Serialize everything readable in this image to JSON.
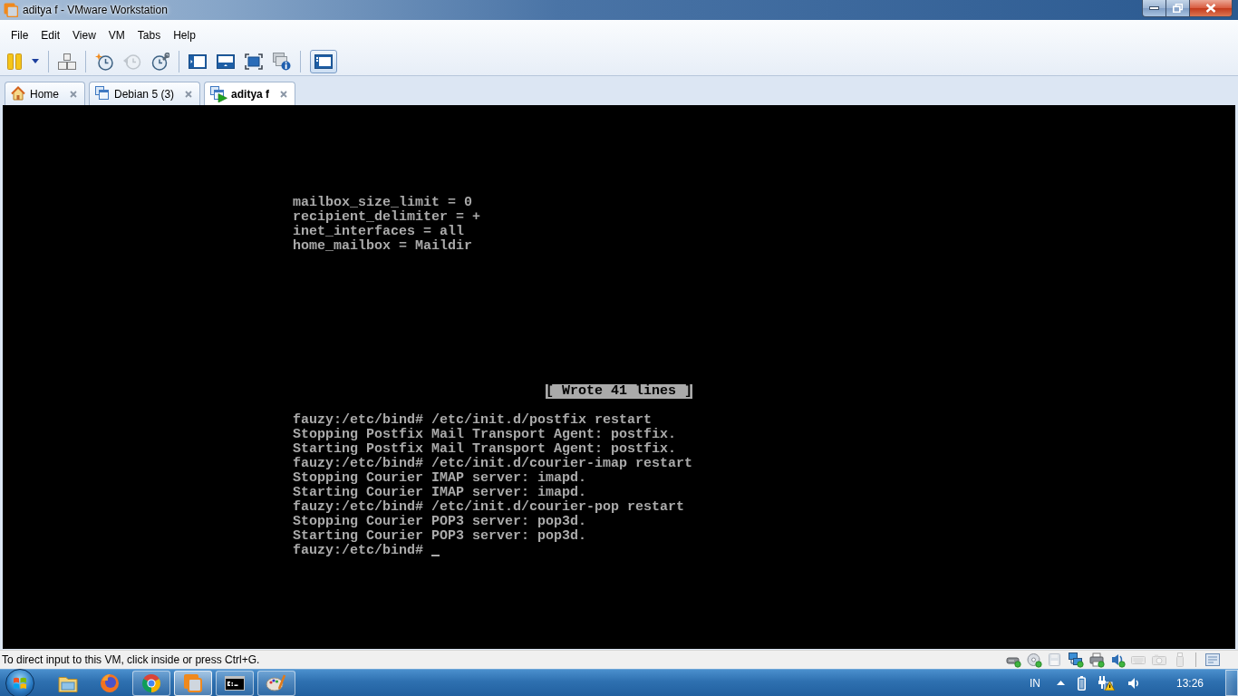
{
  "window": {
    "title": "aditya f - VMware Workstation"
  },
  "menu": [
    "File",
    "Edit",
    "View",
    "VM",
    "Tabs",
    "Help"
  ],
  "toolbar": {
    "groups": [
      [
        {
          "kind": "pause",
          "selected": false,
          "disabled": false
        },
        {
          "kind": "dropdown",
          "selected": false,
          "disabled": false
        }
      ],
      [
        {
          "kind": "send_keys",
          "selected": false,
          "disabled": false
        }
      ],
      [
        {
          "kind": "snapshot",
          "selected": false,
          "disabled": false
        },
        {
          "kind": "revert",
          "selected": false,
          "disabled": true
        },
        {
          "kind": "snapshot_manager",
          "selected": false,
          "disabled": false
        }
      ],
      [
        {
          "kind": "sidebar",
          "selected": false,
          "disabled": false
        },
        {
          "kind": "console_view",
          "selected": false,
          "disabled": false
        },
        {
          "kind": "full_screen",
          "selected": false,
          "disabled": false
        },
        {
          "kind": "unity",
          "selected": false,
          "disabled": false
        }
      ],
      [
        {
          "kind": "thumbnail",
          "selected": true,
          "disabled": false
        }
      ]
    ]
  },
  "tabs": [
    {
      "label": "Home",
      "kind": "home",
      "running": false,
      "selected": false
    },
    {
      "label": "Debian 5 (3)",
      "kind": "vm",
      "running": false,
      "selected": false
    },
    {
      "label": "aditya f",
      "kind": "vm",
      "running": true,
      "selected": true
    }
  ],
  "console": {
    "config_lines": [
      "mailbox_size_limit = 0",
      "recipient_delimiter = +",
      "inet_interfaces = all",
      "home_mailbox = Maildir"
    ],
    "status_message": "[ Wrote 41 lines ]",
    "output_lines": [
      "fauzy:/etc/bind# /etc/init.d/postfix restart",
      "Stopping Postfix Mail Transport Agent: postfix.",
      "Starting Postfix Mail Transport Agent: postfix.",
      "fauzy:/etc/bind# /etc/init.d/courier-imap restart",
      "Stopping Courier IMAP server: imapd.",
      "Starting Courier IMAP server: imapd.",
      "fauzy:/etc/bind# /etc/init.d/courier-pop restart",
      "Stopping Courier POP3 server: pop3d.",
      "Starting Courier POP3 server: pop3d."
    ],
    "prompt": "fauzy:/etc/bind#"
  },
  "status_bar": {
    "message": "To direct input to this VM, click inside or press Ctrl+G.",
    "devices": [
      {
        "kind": "hdd",
        "connected": true
      },
      {
        "kind": "cd",
        "connected": true
      },
      {
        "kind": "floppy",
        "connected": false
      },
      {
        "kind": "network",
        "connected": true
      },
      {
        "kind": "printer",
        "connected": true
      },
      {
        "kind": "sound",
        "connected": true
      },
      {
        "kind": "keyboard",
        "connected": false
      },
      {
        "kind": "camera",
        "connected": false
      },
      {
        "kind": "usb",
        "connected": false
      }
    ]
  },
  "taskbar": {
    "items": [
      {
        "kind": "explorer",
        "running": false,
        "selected": false
      },
      {
        "kind": "firefox",
        "running": false,
        "selected": false
      },
      {
        "kind": "chrome",
        "running": true,
        "selected": false
      },
      {
        "kind": "vmware",
        "running": true,
        "selected": true
      },
      {
        "kind": "cmd",
        "running": true,
        "selected": false
      },
      {
        "kind": "paint",
        "running": true,
        "selected": false
      }
    ],
    "tray": {
      "language": "IN",
      "clock": "13:26"
    }
  }
}
